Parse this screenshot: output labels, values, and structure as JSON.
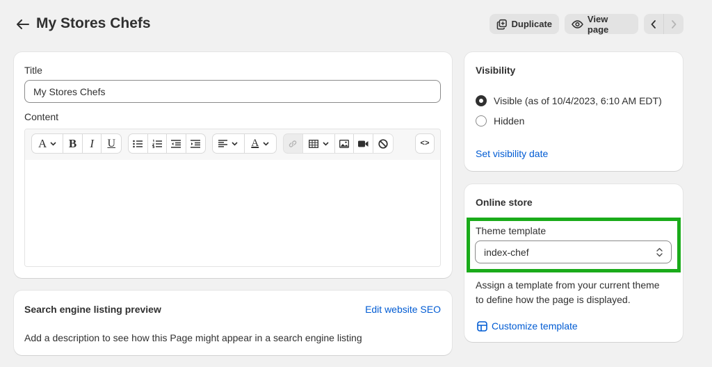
{
  "header": {
    "title": "My Stores Chefs",
    "duplicate_label": "Duplicate",
    "view_page_label": "View page"
  },
  "main": {
    "title_label": "Title",
    "title_value": "My Stores Chefs",
    "content_label": "Content"
  },
  "seo": {
    "heading": "Search engine listing preview",
    "edit_link": "Edit website SEO",
    "description": "Add a description to see how this Page might appear in a search engine listing"
  },
  "visibility": {
    "heading": "Visibility",
    "options": [
      {
        "label": "Visible (as of 10/4/2023, 6:10 AM EDT)",
        "selected": true
      },
      {
        "label": "Hidden",
        "selected": false
      }
    ],
    "set_date_link": "Set visibility date"
  },
  "online_store": {
    "heading": "Online store",
    "template_label": "Theme template",
    "template_value": "index-chef",
    "help_line1": "Assign a template from your current theme",
    "help_line2": "to define how the page is displayed.",
    "customize_link": "Customize template"
  },
  "colors": {
    "link": "#005bd3",
    "highlight": "#1aab1a",
    "background": "#f1f1f1"
  }
}
